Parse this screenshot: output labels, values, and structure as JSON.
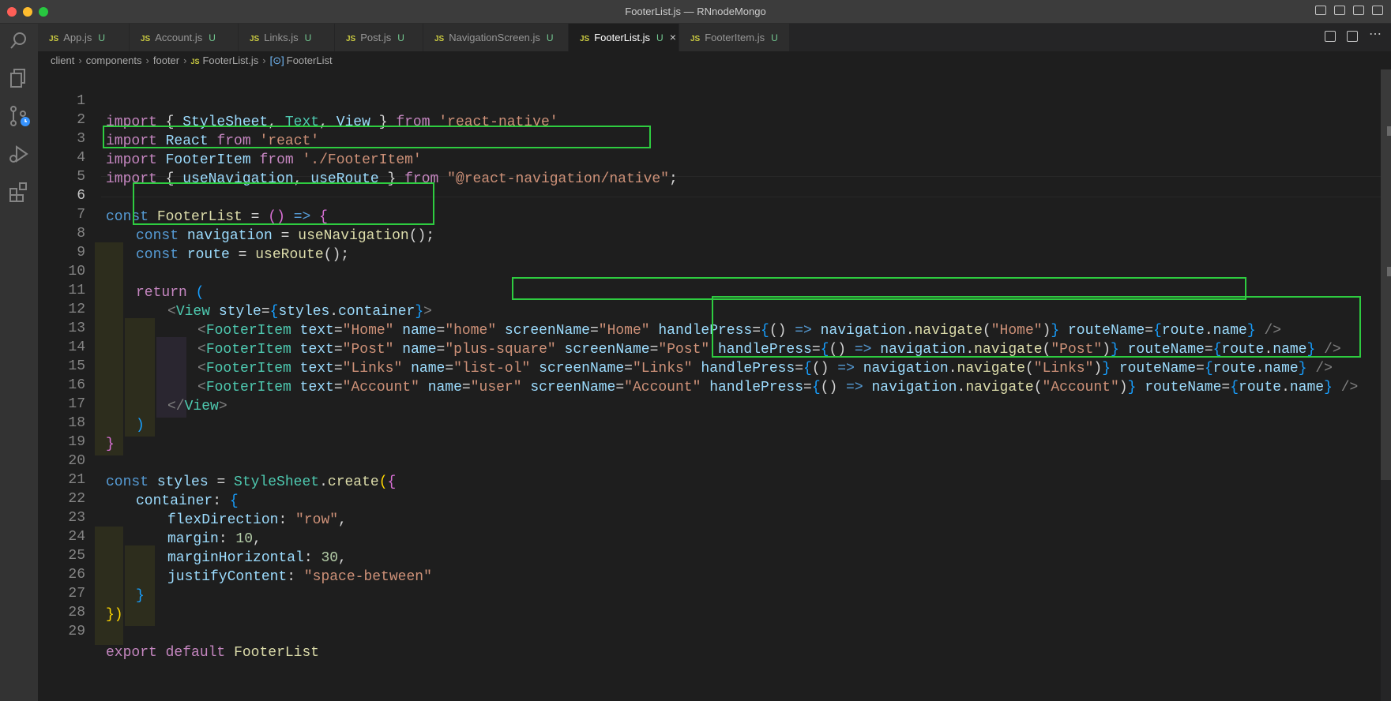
{
  "window": {
    "title": "FooterList.js — RNnodeMongo"
  },
  "tabs": [
    {
      "label": "App.js",
      "status": "U"
    },
    {
      "label": "Account.js",
      "status": "U"
    },
    {
      "label": "Links.js",
      "status": "U"
    },
    {
      "label": "Post.js",
      "status": "U"
    },
    {
      "label": "NavigationScreen.js",
      "status": "U"
    },
    {
      "label": "FooterList.js",
      "status": "U",
      "active": true
    },
    {
      "label": "FooterItem.js",
      "status": "U"
    }
  ],
  "file_badge": "JS",
  "breadcrumb": {
    "parts": [
      "client",
      "components",
      "footer",
      "FooterList.js",
      "FooterList"
    ]
  },
  "activity_bar": [
    "search-icon",
    "explorer-icon",
    "source-control-icon",
    "run-debug-icon",
    "extensions-icon"
  ],
  "editor": {
    "line_numbers": [
      "1",
      "2",
      "3",
      "4",
      "5",
      "6",
      "7",
      "8",
      "9",
      "10",
      "11",
      "12",
      "13",
      "14",
      "15",
      "16",
      "17",
      "18",
      "19",
      "20",
      "21",
      "22",
      "23",
      "24",
      "25",
      "26",
      "27",
      "28",
      "29"
    ],
    "current_line": "6",
    "code": {
      "l1": {
        "a": "import",
        "b": " { ",
        "c": "StyleSheet",
        "d": ", ",
        "e": "Text",
        "f": ", ",
        "g": "View",
        "h": " } ",
        "i": "from",
        "j": " ",
        "k": "'react-native'"
      },
      "l2": {
        "a": "import",
        "b": " ",
        "c": "React",
        "d": " ",
        "e": "from",
        "f": " ",
        "g": "'react'"
      },
      "l3": {
        "a": "import",
        "b": " ",
        "c": "FooterItem",
        "d": " ",
        "e": "from",
        "f": " ",
        "g": "'./FooterItem'"
      },
      "l4": {
        "a": "import",
        "b": " { ",
        "c": "useNavigation",
        "d": ", ",
        "e": "useRoute",
        "f": " } ",
        "g": "from",
        "h": " ",
        "i": "\"@react-navigation/native\"",
        "j": ";"
      },
      "l6": {
        "a": "const",
        "b": " ",
        "c": "FooterList",
        "d": " = ",
        "e": "()",
        "f": " ",
        "g": "=>",
        "h": " ",
        "i": "{"
      },
      "l7": {
        "a": "const",
        "b": " ",
        "c": "navigation",
        "d": " = ",
        "e": "useNavigation",
        "f": "();"
      },
      "l8": {
        "a": "const",
        "b": " ",
        "c": "route",
        "d": " = ",
        "e": "useRoute",
        "f": "();"
      },
      "l10": {
        "a": "return",
        "b": " ",
        "c": "("
      },
      "l11": {
        "a": "<",
        "b": "View",
        "c": " ",
        "d": "style",
        "e": "=",
        "f": "{",
        "g": "styles",
        "h": ".",
        "i": "container",
        "j": "}",
        "k": ">"
      },
      "l12": {
        "a": "<",
        "b": "FooterItem",
        "c": " text",
        "d": "=",
        "e": "\"Home\"",
        "f": " name",
        "g": "=",
        "h": "\"home\"",
        "i": " screenName",
        "j": "=",
        "k": "\"Home\"",
        "l": " handlePress",
        "m": "=",
        "n": "{",
        "o": "()",
        "p": " => ",
        "q": "navigation",
        "r": ".",
        "s": "navigate",
        "t": "(",
        "u": "\"Home\"",
        "v": ")",
        "w": "}",
        "x": " routeName",
        "y": "=",
        "z": "{",
        "za": "route",
        "zb": ".",
        "zc": "name",
        "zd": "}",
        "ze": " />"
      },
      "l13": {
        "a": "<",
        "b": "FooterItem",
        "c": " text",
        "d": "=",
        "e": "\"Post\"",
        "f": " name",
        "g": "=",
        "h": "\"plus-square\"",
        "i": " screenName",
        "j": "=",
        "k": "\"Post\"",
        "l": " handlePress",
        "m": "=",
        "n": "{",
        "o": "()",
        "p": " => ",
        "q": "navigation",
        "r": ".",
        "s": "navigate",
        "t": "(",
        "u": "\"Post\"",
        "v": ")",
        "w": "}",
        "x": " routeName",
        "y": "=",
        "z": "{",
        "za": "route",
        "zb": ".",
        "zc": "name",
        "zd": "}",
        "ze": " />"
      },
      "l14": {
        "a": "<",
        "b": "FooterItem",
        "c": " text",
        "d": "=",
        "e": "\"Links\"",
        "f": " name",
        "g": "=",
        "h": "\"list-ol\"",
        "i": " screenName",
        "j": "=",
        "k": "\"Links\"",
        "l": " handlePress",
        "m": "=",
        "n": "{",
        "o": "()",
        "p": " => ",
        "q": "navigation",
        "r": ".",
        "s": "navigate",
        "t": "(",
        "u": "\"Links\"",
        "v": ")",
        "w": "}",
        "x": " routeName",
        "y": "=",
        "z": "{",
        "za": "route",
        "zb": ".",
        "zc": "name",
        "zd": "}",
        "ze": " />"
      },
      "l15": {
        "a": "<",
        "b": "FooterItem",
        "c": " text",
        "d": "=",
        "e": "\"Account\"",
        "f": " name",
        "g": "=",
        "h": "\"user\"",
        "i": " screenName",
        "j": "=",
        "k": "\"Account\"",
        "l": " handlePress",
        "m": "=",
        "n": "{",
        "o": "()",
        "p": " => ",
        "q": "navigation",
        "r": ".",
        "s": "navigate",
        "t": "(",
        "u": "\"Account\"",
        "v": ")",
        "w": "}",
        "x": " routeName",
        "y": "=",
        "z": "{",
        "za": "route",
        "zb": ".",
        "zc": "name",
        "zd": "}",
        "ze": " />"
      },
      "l16": {
        "a": "</",
        "b": "View",
        "c": ">"
      },
      "l17": {
        "a": ")"
      },
      "l18": {
        "a": "}"
      },
      "l20": {
        "a": "const",
        "b": " ",
        "c": "styles",
        "d": " = ",
        "e": "StyleSheet",
        "f": ".",
        "g": "create",
        "h": "(",
        "i": "{"
      },
      "l21": {
        "a": "container",
        "b": ": ",
        "c": "{"
      },
      "l22": {
        "a": "flexDirection",
        "b": ": ",
        "c": "\"row\"",
        "d": ","
      },
      "l23": {
        "a": "margin",
        "b": ": ",
        "c": "10",
        "d": ","
      },
      "l24": {
        "a": "marginHorizontal",
        "b": ": ",
        "c": "30",
        "d": ","
      },
      "l25": {
        "a": "justifyContent",
        "b": ": ",
        "c": "\"space-between\""
      },
      "l26": {
        "a": "}"
      },
      "l27": {
        "a": "})"
      },
      "l29": {
        "a": "export",
        "b": " ",
        "c": "default",
        "d": " ",
        "e": "FooterList"
      }
    }
  },
  "colors": {
    "highlight_box": "#2ecc40",
    "keyword": "#569cd6",
    "string": "#ce9178",
    "function": "#dcdcaa"
  }
}
